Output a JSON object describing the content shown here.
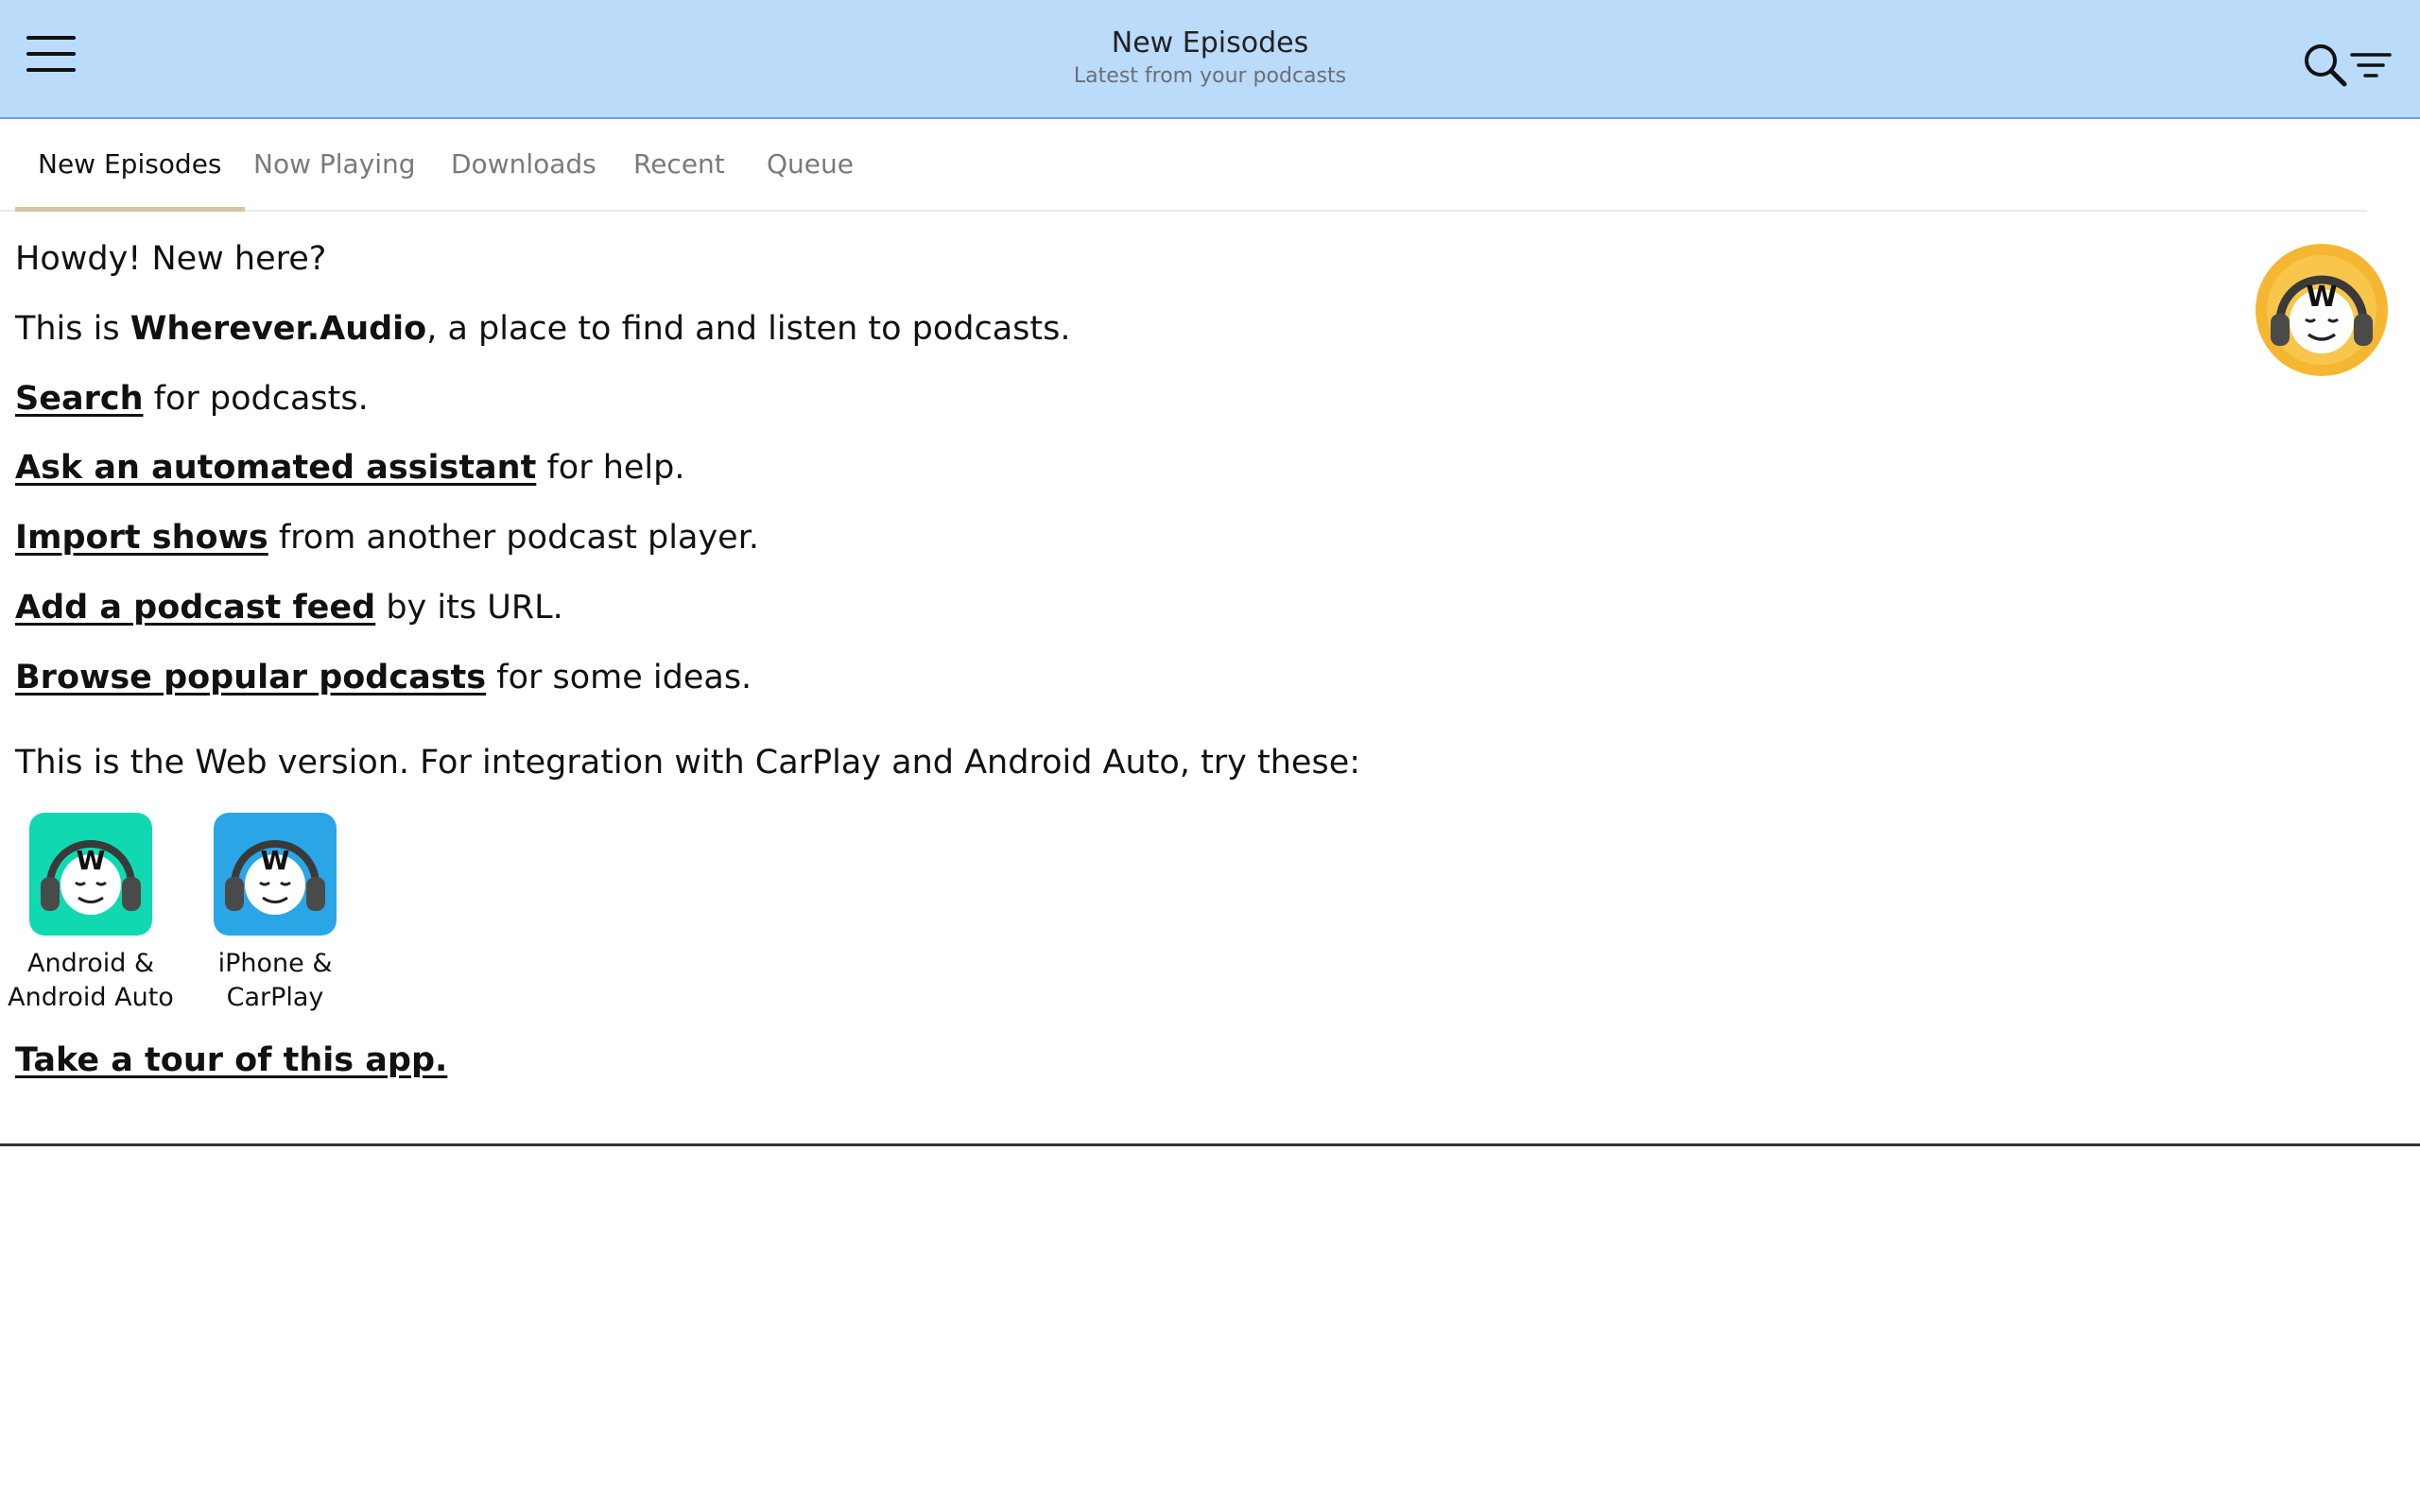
{
  "appbar": {
    "title": "New Episodes",
    "subtitle": "Latest from your podcasts",
    "menu_icon": "hamburger-menu-icon",
    "search_icon": "search-icon",
    "filter_icon": "filter-sort-icon",
    "background_color": "#bbdbfb"
  },
  "tabs": [
    {
      "label": "New Episodes",
      "active": true
    },
    {
      "label": "Now Playing",
      "active": false
    },
    {
      "label": "Downloads",
      "active": false
    },
    {
      "label": "Recent",
      "active": false
    },
    {
      "label": "Queue",
      "active": false
    }
  ],
  "welcome": {
    "greeting": "Howdy! New here?",
    "intro_prefix": "This is ",
    "intro_brand": "Wherever.Audio",
    "intro_suffix": ", a place to find and listen to podcasts.",
    "actions": [
      {
        "link": "Search",
        "rest": " for podcasts."
      },
      {
        "link": "Ask an automated assistant",
        "rest": " for help."
      },
      {
        "link": "Import shows",
        "rest": " from another podcast player."
      },
      {
        "link": "Add a podcast feed",
        "rest": " by its URL."
      },
      {
        "link": "Browse popular podcasts",
        "rest": " for some ideas."
      }
    ],
    "integration_text": "This is the Web version. For integration with CarPlay and Android Auto, try these:",
    "apps": [
      {
        "caption_line1": "Android &",
        "caption_line2": "Android Auto",
        "color": "#10d9b2"
      },
      {
        "caption_line1": "iPhone &",
        "caption_line2": "CarPlay",
        "color": "#2aa6e6"
      }
    ],
    "tour_link": "Take a tour of this app."
  },
  "mascot": {
    "icon": "wherever-audio-mascot-icon",
    "ring_color": "#f5b731"
  }
}
